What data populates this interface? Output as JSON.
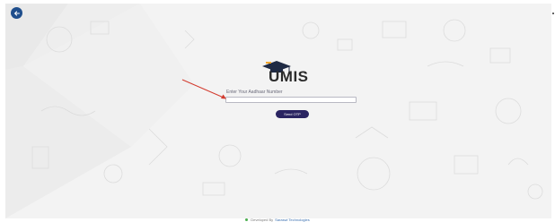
{
  "header": {
    "back_icon": "arrow-left-icon"
  },
  "logo": {
    "text": "UMIS",
    "icon": "graduation-cap-icon"
  },
  "form": {
    "label": "Enter Your Aadhaar Number",
    "input_value": "",
    "submit_label": "Send OTP"
  },
  "footer": {
    "prefix": "Developed By",
    "brand": "Saraswi Technologies"
  },
  "colors": {
    "primary_button": "#2a2461",
    "back_button": "#1f4e8c",
    "annotation_arrow": "#d33b2f"
  }
}
